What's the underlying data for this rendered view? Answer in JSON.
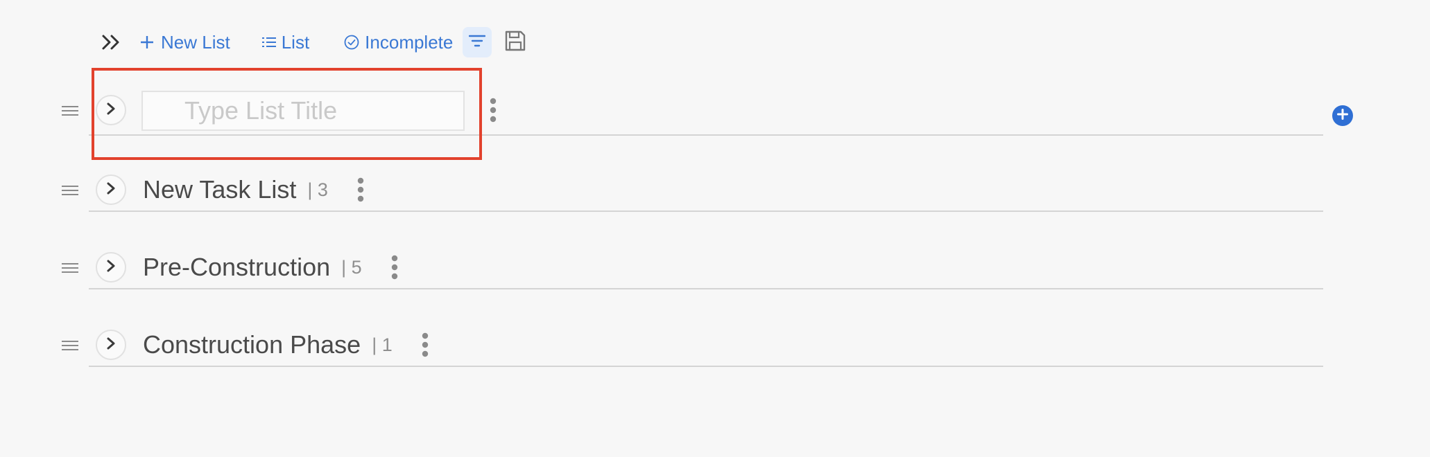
{
  "toolbar": {
    "expand_icon": "double-chevron-right-icon",
    "new_list_label": "New List",
    "view_label": "List",
    "filter_status_label": "Incomplete",
    "filter_icon": "filter-icon",
    "save_icon": "save-icon"
  },
  "editing_row": {
    "placeholder": "Type List Title",
    "value": ""
  },
  "lists": [
    {
      "title": "New Task List",
      "count": "| 3"
    },
    {
      "title": "Pre-Construction",
      "count": "| 5"
    },
    {
      "title": "Construction Phase",
      "count": "| 1"
    }
  ],
  "colors": {
    "accent": "#3a78d4",
    "highlight": "#e2422d",
    "add_button": "#2f6fd4"
  }
}
